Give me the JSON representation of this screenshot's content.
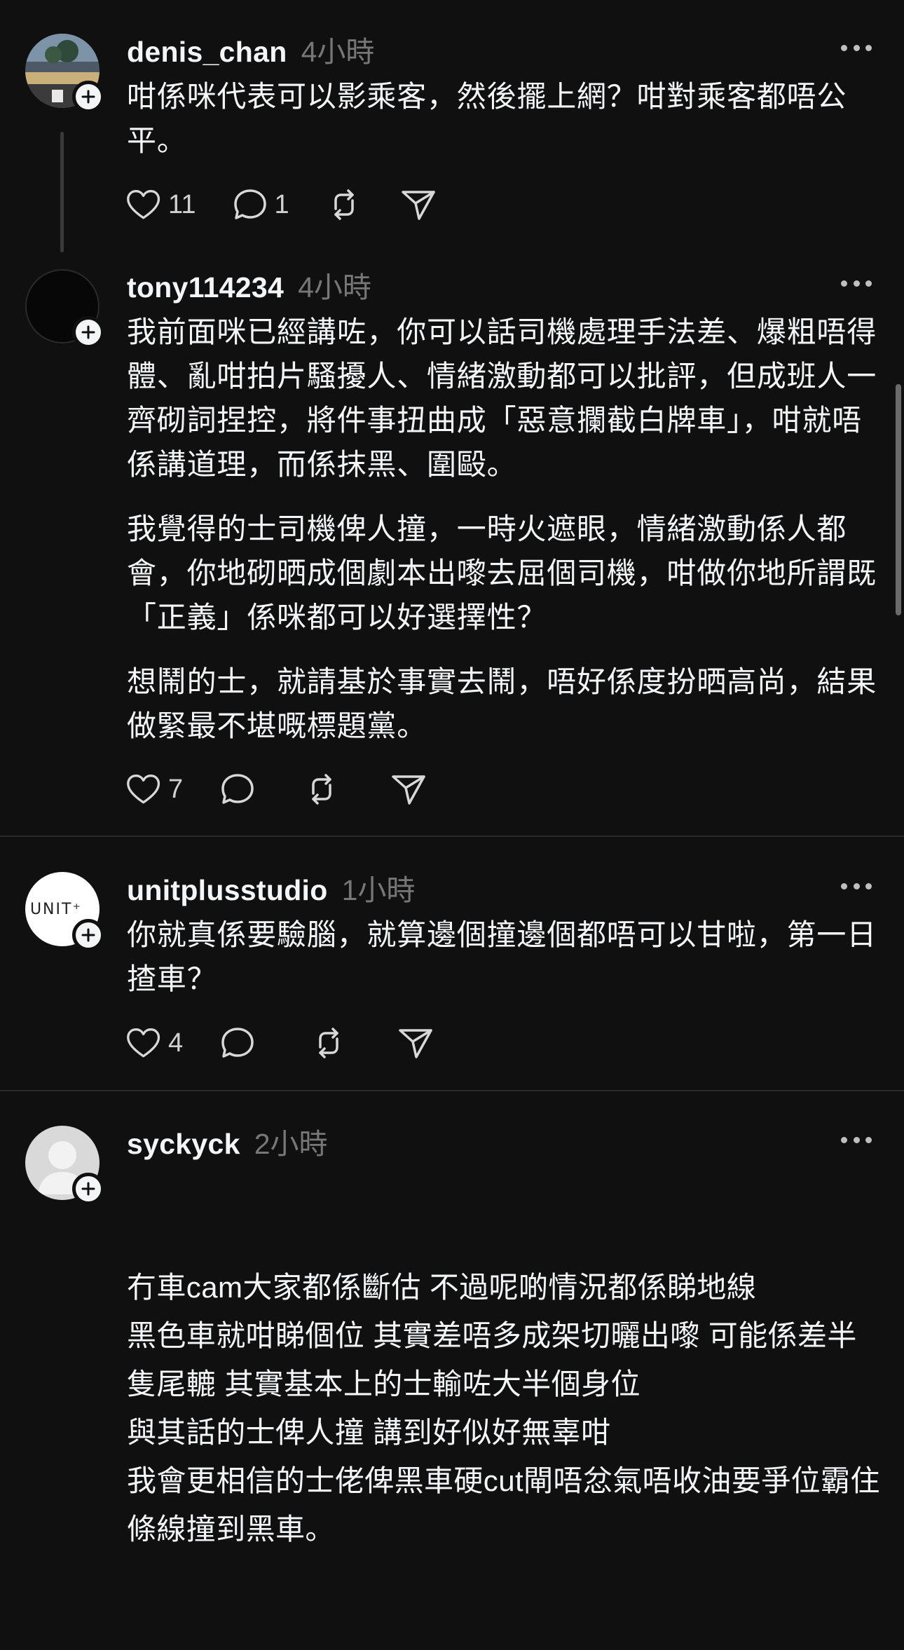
{
  "posts": [
    {
      "username": "denis_chan",
      "time": "4小時",
      "paragraphs": [
        "咁係咪代表可以影乘客，然後擺上網？咁對乘客都唔公平。"
      ],
      "likes": "11",
      "replies": "1",
      "avatar": "photo-avatar",
      "has_thread_line": true
    },
    {
      "username": "tony114234",
      "time": "4小時",
      "paragraphs": [
        "我前面咪已經講咗，你可以話司機處理手法差、爆粗唔得體、亂咁拍片騷擾人、情緒激動都可以批評，但成班人一齊砌詞捏控，將件事扭曲成「惡意攔截白牌車」，咁就唔係講道理，而係抹黑、圍毆。",
        "我覺得的士司機俾人撞，一時火遮眼，情緒激動係人都會，你地砌晒成個劇本出嚟去屈個司機，咁做你地所謂既「正義」係咪都可以好選擇性？",
        "想鬧的士，就請基於事實去鬧，唔好係度扮晒高尚，結果做緊最不堪嘅標題黨。"
      ],
      "likes": "7",
      "replies": "",
      "avatar": "dark-avatar"
    },
    {
      "username": "unitplusstudio",
      "time": "1小時",
      "paragraphs": [
        "你就真係要驗腦，就算邊個撞邊個都唔可以甘啦，第一日揸車？"
      ],
      "likes": "4",
      "replies": "",
      "avatar": "logo-avatar",
      "logo_text": "UNIT⁺"
    },
    {
      "username": "syckyck",
      "time": "2小時",
      "paragraphs": [
        "冇車cam大家都係斷估 不過呢啲情況都係睇地線\n黑色車就咁睇個位 其實差唔多成架切曬出嚟 可能係差半隻尾轆 其實基本上的士輸咗大半個身位\n與其話的士俾人撞 講到好似好無辜咁\n我會更相信的士佬俾黑車硬cut閘唔忿氣唔收油要爭位霸住條線撞到黑車。"
      ],
      "avatar": "default-avatar"
    }
  ],
  "colors": {
    "background": "#101010",
    "text": "#f3f5f7",
    "muted": "#777777",
    "divider": "#2a2a2a"
  }
}
